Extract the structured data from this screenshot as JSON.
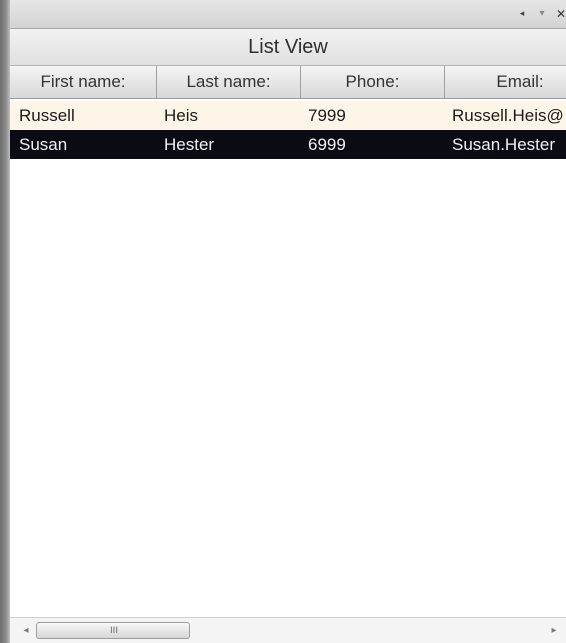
{
  "panel": {
    "dock_buttons": {
      "pin_icon": "◂",
      "menu_icon": "▾",
      "close_icon": "✕"
    },
    "title": "List View"
  },
  "columns": [
    {
      "label": "First name:"
    },
    {
      "label": "Last name:"
    },
    {
      "label": "Phone:"
    },
    {
      "label": "Email:"
    }
  ],
  "rows": [
    {
      "first": "Russell",
      "last": "Heis",
      "phone": "7999",
      "email": "Russell.Heis@",
      "selected": false
    },
    {
      "first": "Susan",
      "last": "Hester",
      "phone": "6999",
      "email": "Susan.Hester",
      "selected": true
    }
  ],
  "scrollbar": {
    "left_arrow": "◂",
    "right_arrow": "▸",
    "grip": "III"
  },
  "colors": {
    "selected_row_bg": "#0b0b14",
    "selected_row_text": "#f2f2f2",
    "first_row_bg": "#fdf6e8"
  }
}
